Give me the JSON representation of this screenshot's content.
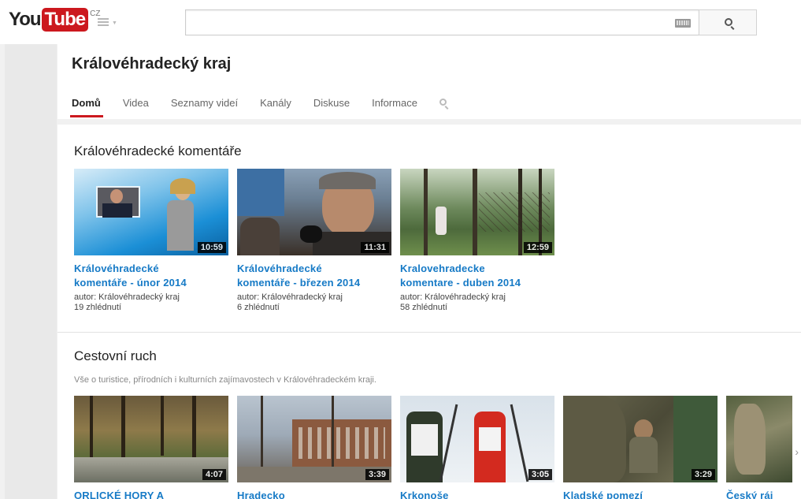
{
  "masthead": {
    "logo_you": "You",
    "logo_tube": "Tube",
    "logo_region": "CZ",
    "search_value": "",
    "search_placeholder": ""
  },
  "channel": {
    "title": "Královéhradecký kraj",
    "tabs": [
      {
        "label": "Domů",
        "active": true
      },
      {
        "label": "Videa",
        "active": false
      },
      {
        "label": "Seznamy videí",
        "active": false
      },
      {
        "label": "Kanály",
        "active": false
      },
      {
        "label": "Diskuse",
        "active": false
      },
      {
        "label": "Informace",
        "active": false
      }
    ]
  },
  "sections": [
    {
      "title": "Královéhradecké komentáře",
      "videos": [
        {
          "title_line1": "Královéhradecké",
          "title_line2": "komentáře - únor 2014",
          "author": "autor: Královéhradecký kraj",
          "views": "19 zhlédnutí",
          "duration": "10:59"
        },
        {
          "title_line1": "Královéhradecké",
          "title_line2": "komentáře - březen 2014",
          "author": "autor: Královéhradecký kraj",
          "views": "6 zhlédnutí",
          "duration": "11:31"
        },
        {
          "title_line1": "Kralovehradecke",
          "title_line2": "komentare - duben 2014",
          "author": "autor: Královéhradecký kraj",
          "views": "58 zhlédnutí",
          "duration": "12:59"
        }
      ]
    },
    {
      "title": "Cestovní ruch",
      "description": "Vše o turistice, přírodních i kulturních zajímavostech v Královéhradeckém kraji.",
      "videos": [
        {
          "title": "ORLICKÉ HORY A",
          "duration": "4:07"
        },
        {
          "title": "Hradecko",
          "duration": "3:39"
        },
        {
          "title": "Krkonoše",
          "duration": "3:05"
        },
        {
          "title": "Kladské pomezí",
          "duration": "3:29"
        },
        {
          "title": "Český ráj",
          "duration": ""
        }
      ]
    }
  ],
  "colors": {
    "brand_red": "#cc181e",
    "link_blue": "#167ac6"
  },
  "icons": {
    "search": "search-icon",
    "keyboard": "keyboard-icon",
    "menu": "menu-icon",
    "next": "chevron-right-icon"
  }
}
